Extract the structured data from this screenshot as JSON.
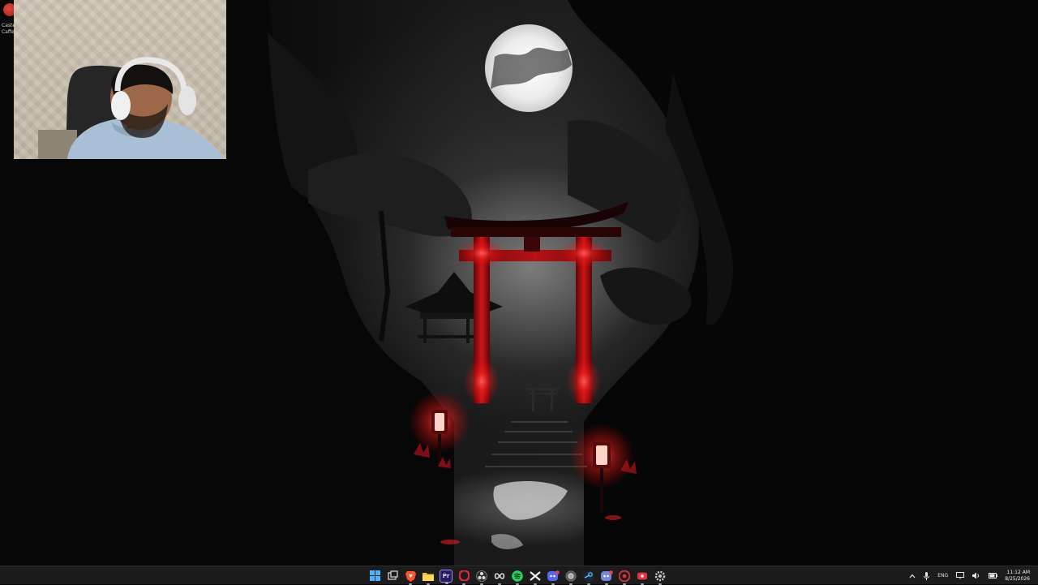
{
  "desktop": {
    "icons": [
      {
        "label": "Caste\nCaffe",
        "icon": "coffee-app-icon"
      }
    ]
  },
  "taskbar": {
    "apps": [
      {
        "name": "start",
        "icon": "windows-start-icon",
        "color": "#3aa0ff"
      },
      {
        "name": "task-view",
        "icon": "task-view-icon",
        "color": "#cfcfcf"
      },
      {
        "name": "brave",
        "icon": "brave-browser-icon",
        "color": "#fb542b",
        "running": true
      },
      {
        "name": "file-explorer",
        "icon": "folder-icon",
        "color": "#f2c230",
        "running": true
      },
      {
        "name": "premiere-pro",
        "icon": "premiere-pro-icon",
        "color": "#2a1a5e",
        "text": "Pr",
        "running": true
      },
      {
        "name": "opera-gx",
        "icon": "opera-icon",
        "color": "#e8233a",
        "running": true
      },
      {
        "name": "obs",
        "icon": "obs-icon",
        "color": "#3a3a3a",
        "running": true
      },
      {
        "name": "infinity-app",
        "icon": "infinity-icon",
        "color": "#5a5a5a",
        "running": true
      },
      {
        "name": "spotify",
        "icon": "spotify-icon",
        "color": "#1ed760",
        "running": true
      },
      {
        "name": "capcut",
        "icon": "capcut-icon",
        "color": "#eaeaea",
        "running": true
      },
      {
        "name": "discord",
        "icon": "discord-icon",
        "color": "#5865f2",
        "running": true
      },
      {
        "name": "chrome",
        "icon": "chrome-icon",
        "color": "#7a7a7a",
        "running": true
      },
      {
        "name": "steam",
        "icon": "steam-icon",
        "color": "#1b6fa8",
        "running": true
      },
      {
        "name": "discord-ptb",
        "icon": "discord-badge-icon",
        "color": "#7289da",
        "running": true
      },
      {
        "name": "media-app",
        "icon": "red-circle-app-icon",
        "color": "#d1323a",
        "running": true
      },
      {
        "name": "red-app",
        "icon": "red-app-icon",
        "color": "#e0333c",
        "running": true
      },
      {
        "name": "settings",
        "icon": "gear-icon",
        "color": "#bdbdbd",
        "running": true
      }
    ]
  },
  "tray": {
    "chevron_icon": "chevron-up-icon",
    "mic_icon": "microphone-icon",
    "language": "ENG",
    "network_icon": "network-icon",
    "volume_icon": "volume-icon",
    "battery_icon": "battery-icon",
    "time": "11:12 AM",
    "date": "8/25/2026"
  },
  "colors": {
    "taskbar_bg": "#1c1c1c",
    "torii_red": "#c8141e",
    "lantern_glow": "#ff3a3a"
  }
}
